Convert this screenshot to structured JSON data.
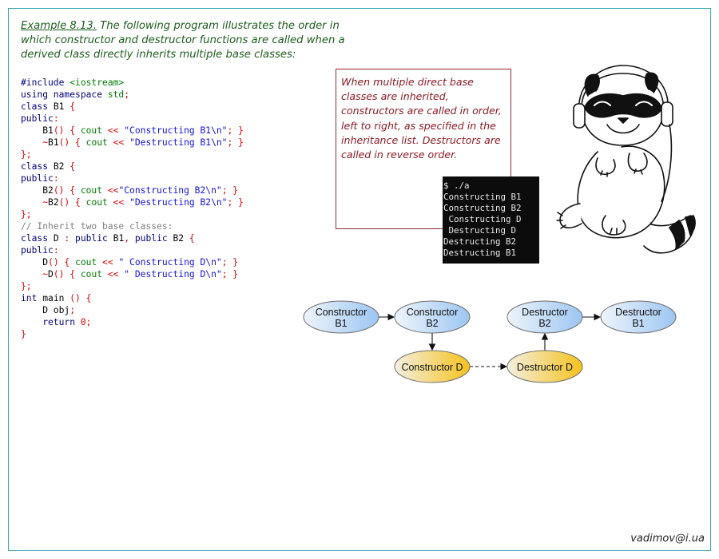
{
  "intro": {
    "label": "Example 8.13.",
    "text": " The following program illustrates the order in which constructor and destructor functions are called when a derived class directly inherits multiple base classes:"
  },
  "code_lines": [
    [
      {
        "c": "kw",
        "t": "#include "
      },
      {
        "c": "hd",
        "t": "<iostream>"
      }
    ],
    [
      {
        "c": "kw",
        "t": "using namespace "
      },
      {
        "c": "fn",
        "t": "std"
      },
      {
        "c": "pn",
        "t": ";"
      }
    ],
    [
      {
        "c": "kw",
        "t": "class "
      },
      {
        "c": "pl",
        "t": "B1 "
      },
      {
        "c": "pn",
        "t": "{"
      }
    ],
    [
      {
        "c": "kw",
        "t": "public"
      },
      {
        "c": "pn",
        "t": ":"
      }
    ],
    [
      {
        "c": "pl",
        "t": "    B1"
      },
      {
        "c": "pn",
        "t": "() { "
      },
      {
        "c": "fn",
        "t": "cout "
      },
      {
        "c": "pn",
        "t": "<< "
      },
      {
        "c": "st",
        "t": "\"Constructing B1\\n\""
      },
      {
        "c": "pn",
        "t": "; }"
      }
    ],
    [
      {
        "c": "pn",
        "t": "    ~"
      },
      {
        "c": "pl",
        "t": "B1"
      },
      {
        "c": "pn",
        "t": "() { "
      },
      {
        "c": "fn",
        "t": "cout "
      },
      {
        "c": "pn",
        "t": "<< "
      },
      {
        "c": "st",
        "t": "\"Destructing B1\\n\""
      },
      {
        "c": "pn",
        "t": "; }"
      }
    ],
    [
      {
        "c": "pn",
        "t": "};"
      }
    ],
    [
      {
        "c": "kw",
        "t": "class "
      },
      {
        "c": "pl",
        "t": "B2 "
      },
      {
        "c": "pn",
        "t": "{"
      }
    ],
    [
      {
        "c": "kw",
        "t": "public"
      },
      {
        "c": "pn",
        "t": ":"
      }
    ],
    [
      {
        "c": "pl",
        "t": "    B2"
      },
      {
        "c": "pn",
        "t": "() { "
      },
      {
        "c": "fn",
        "t": "cout "
      },
      {
        "c": "pn",
        "t": "<<"
      },
      {
        "c": "st",
        "t": "\"Constructing B2\\n\""
      },
      {
        "c": "pn",
        "t": "; }"
      }
    ],
    [
      {
        "c": "pn",
        "t": "    ~"
      },
      {
        "c": "pl",
        "t": "B2"
      },
      {
        "c": "pn",
        "t": "() { "
      },
      {
        "c": "fn",
        "t": "cout "
      },
      {
        "c": "pn",
        "t": "<< "
      },
      {
        "c": "st",
        "t": "\"Destructing B2\\n\""
      },
      {
        "c": "pn",
        "t": "; }"
      }
    ],
    [
      {
        "c": "pn",
        "t": "};"
      }
    ],
    [
      {
        "c": "cm",
        "t": "// Inherit two base classes:"
      }
    ],
    [
      {
        "c": "kw",
        "t": "class "
      },
      {
        "c": "pl",
        "t": "D "
      },
      {
        "c": "pn",
        "t": ": "
      },
      {
        "c": "kw",
        "t": "public "
      },
      {
        "c": "pl",
        "t": "B1"
      },
      {
        "c": "pn",
        "t": ", "
      },
      {
        "c": "kw",
        "t": "public "
      },
      {
        "c": "pl",
        "t": "B2 "
      },
      {
        "c": "pn",
        "t": "{"
      }
    ],
    [
      {
        "c": "kw",
        "t": "public"
      },
      {
        "c": "pn",
        "t": ":"
      }
    ],
    [
      {
        "c": "pl",
        "t": "    D"
      },
      {
        "c": "pn",
        "t": "() { "
      },
      {
        "c": "fn",
        "t": "cout "
      },
      {
        "c": "pn",
        "t": "<< "
      },
      {
        "c": "st",
        "t": "\" Constructing D\\n\""
      },
      {
        "c": "pn",
        "t": "; }"
      }
    ],
    [
      {
        "c": "pn",
        "t": "    ~"
      },
      {
        "c": "pl",
        "t": "D"
      },
      {
        "c": "pn",
        "t": "() { "
      },
      {
        "c": "fn",
        "t": "cout "
      },
      {
        "c": "pn",
        "t": "<< "
      },
      {
        "c": "st",
        "t": "\" Destructing D\\n\""
      },
      {
        "c": "pn",
        "t": "; }"
      }
    ],
    [
      {
        "c": "pn",
        "t": "};"
      }
    ],
    [
      {
        "c": "ty",
        "t": "int "
      },
      {
        "c": "pl",
        "t": "main "
      },
      {
        "c": "pn",
        "t": "() {"
      }
    ],
    [
      {
        "c": "pl",
        "t": "    D obj"
      },
      {
        "c": "pn",
        "t": ";"
      }
    ],
    [
      {
        "c": "kw",
        "t": "    return "
      },
      {
        "c": "nu",
        "t": "0"
      },
      {
        "c": "pn",
        "t": ";"
      }
    ],
    [
      {
        "c": "pn",
        "t": "}"
      }
    ]
  ],
  "note": "When multiple direct base classes are inherited, constructors are called in order, left to right, as specified in the inheritance list. Destructors are called in reverse order.",
  "terminal_lines": [
    "$ ./a",
    "Constructing B1",
    "Constructing B2",
    " Constructing D",
    " Destructing D",
    "Destructing B2",
    "Destructing B1"
  ],
  "diagram": {
    "nodes": [
      {
        "id": "cb1",
        "line1": "Constructor",
        "line2": "B1",
        "color": "blue"
      },
      {
        "id": "cb2",
        "line1": "Constructor",
        "line2": "B2",
        "color": "blue"
      },
      {
        "id": "cd",
        "line1": "Constructor D",
        "line2": "",
        "color": "gold"
      },
      {
        "id": "dd",
        "line1": "Destructor D",
        "line2": "",
        "color": "gold"
      },
      {
        "id": "db2",
        "line1": "Destructor",
        "line2": "B2",
        "color": "blue"
      },
      {
        "id": "db1",
        "line1": "Destructor",
        "line2": "B1",
        "color": "blue"
      }
    ],
    "colors": {
      "blue_light": "#eef4fb",
      "blue_dark": "#9cc6f2",
      "gold_light": "#f3efe0",
      "gold_dark": "#f4c21c",
      "stroke": "#6e6e6e"
    }
  },
  "illustration": {
    "icon": "raccoon-with-headphones-illustration"
  },
  "signature": "vadimov@i.ua"
}
